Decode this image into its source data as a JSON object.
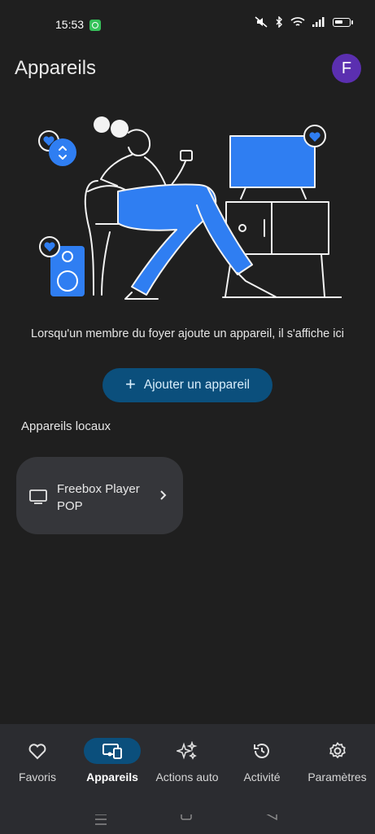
{
  "status_bar": {
    "time": "15:53"
  },
  "header": {
    "title": "Appareils",
    "avatar_letter": "F"
  },
  "empty_state": {
    "message": "Lorsqu'un membre du foyer ajoute un appareil, il s'affiche ici"
  },
  "add_button": {
    "label": "Ajouter un appareil"
  },
  "local_devices": {
    "section_title": "Appareils locaux",
    "items": [
      {
        "name": "Freebox Player POP",
        "icon": "tv-icon"
      }
    ]
  },
  "bottom_nav": {
    "items": [
      {
        "label": "Favoris",
        "icon": "heart-icon",
        "active": false
      },
      {
        "label": "Appareils",
        "icon": "devices-icon",
        "active": true
      },
      {
        "label": "Actions auto",
        "icon": "sparkle-icon",
        "active": false
      },
      {
        "label": "Activité",
        "icon": "history-icon",
        "active": false
      },
      {
        "label": "Paramètres",
        "icon": "gear-icon",
        "active": false
      }
    ]
  },
  "colors": {
    "accent": "#0b4f7c",
    "avatar": "#5b2fb0",
    "illustration_blue": "#2f7ef2",
    "background": "#1f1f1f"
  }
}
